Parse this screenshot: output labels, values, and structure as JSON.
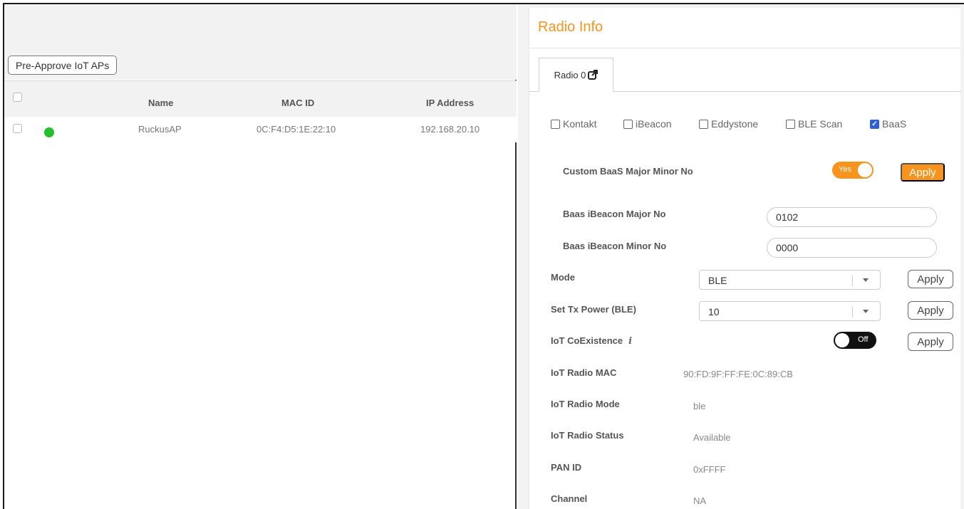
{
  "left": {
    "preapprove_label": "Pre-Approve IoT APs",
    "columns": [
      "Name",
      "MAC ID",
      "IP Address"
    ],
    "rows": [
      {
        "status": "online",
        "name": "RuckusAP",
        "mac": "0C:F4:D5:1E:22:10",
        "ip": "192.168.20.10"
      }
    ]
  },
  "radio_info": {
    "title": "Radio Info",
    "tab_label": "Radio 0",
    "beacons": [
      {
        "label": "Kontakt",
        "checked": false
      },
      {
        "label": "iBeacon",
        "checked": false
      },
      {
        "label": "Eddystone",
        "checked": false
      },
      {
        "label": "BLE Scan",
        "checked": false
      },
      {
        "label": "BaaS",
        "checked": true
      }
    ],
    "custom_baas_label": "Custom BaaS Major Minor No",
    "custom_baas_toggle": "Yes",
    "apply_label": "Apply",
    "major_label": "Baas iBeacon Major No",
    "major_value": "0102",
    "minor_label": "Baas iBeacon Minor No",
    "minor_value": "0000",
    "mode_label": "Mode",
    "mode_value": "BLE",
    "tx_power_label": "Set Tx Power (BLE)",
    "tx_power_value": "10",
    "coexistence_label": "IoT CoExistence",
    "coexistence_toggle": "Off",
    "info_glyph": "i",
    "radio_mac_label": "IoT Radio MAC",
    "radio_mac_value": "90:FD:9F:FF:FE:0C:89:CB",
    "radio_mode_label": "IoT Radio Mode",
    "radio_mode_value": "ble",
    "radio_status_label": "IoT Radio Status",
    "radio_status_value": "Available",
    "pan_id_label": "PAN ID",
    "pan_id_value": "0xFFFF",
    "channel_label": "Channel",
    "channel_value": "NA"
  },
  "colors": {
    "accent": "#f7941d",
    "online": "#22c02a",
    "checked": "#2f5fd0"
  }
}
